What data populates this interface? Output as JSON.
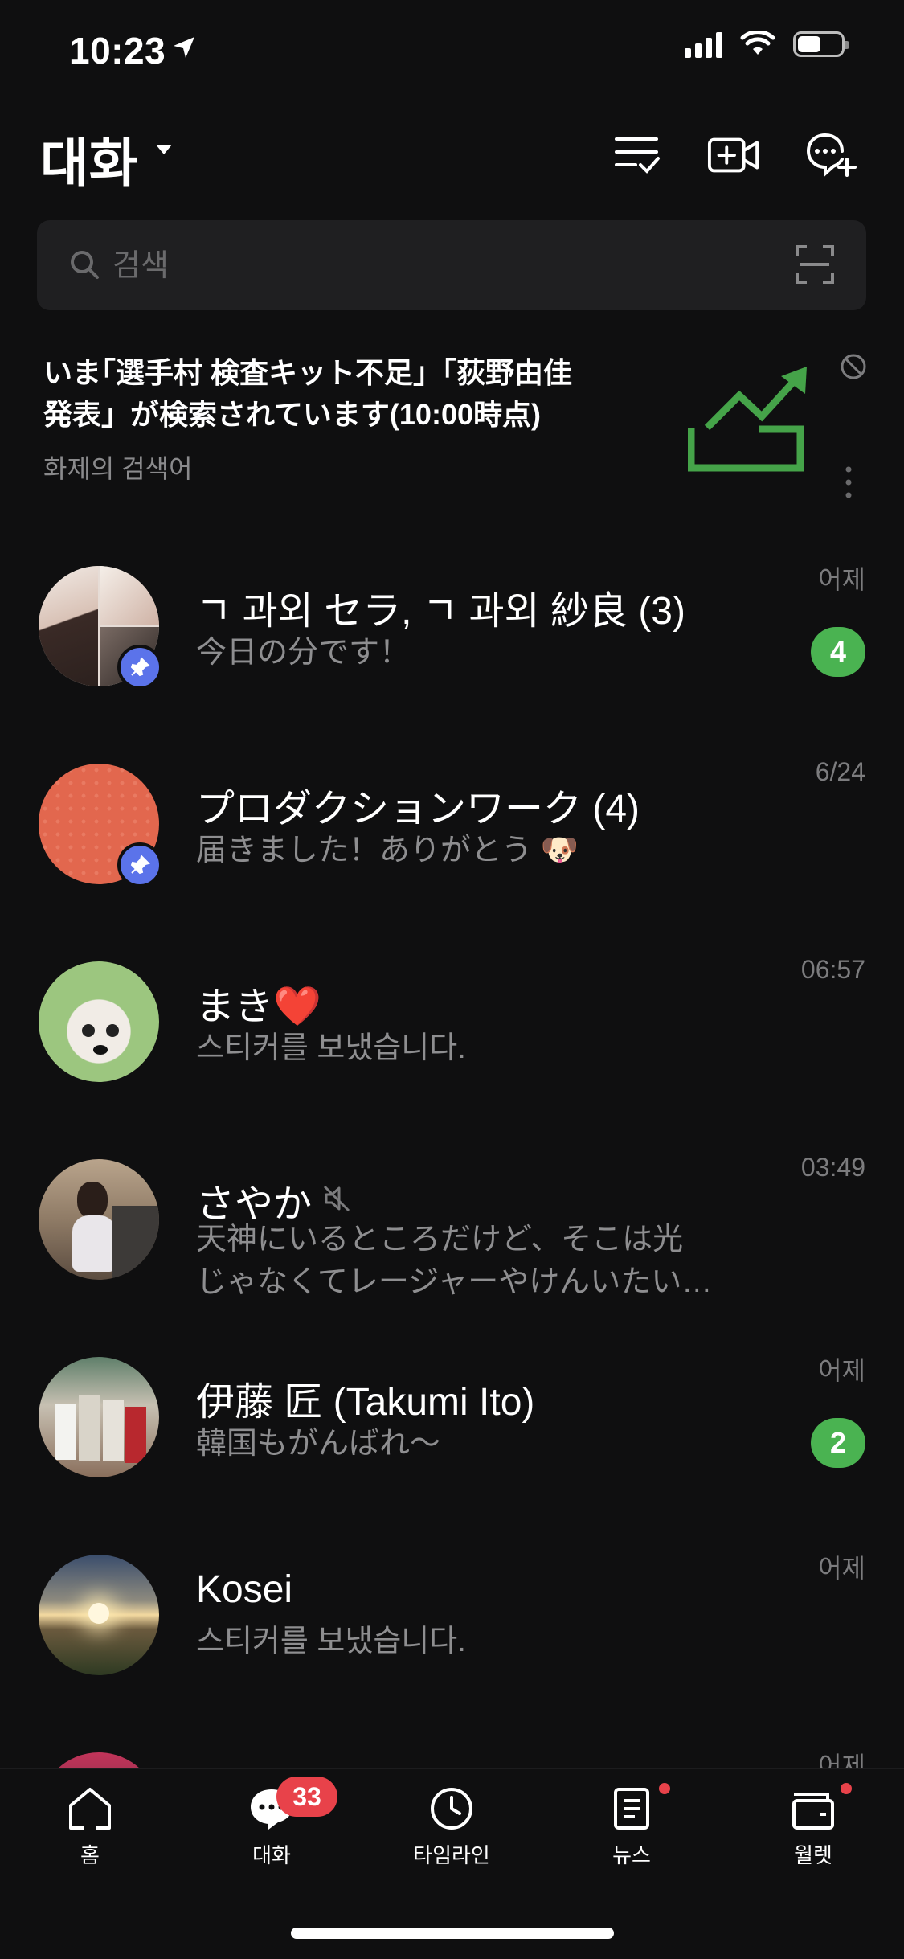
{
  "status_bar": {
    "time": "10:23"
  },
  "header": {
    "title": "대화"
  },
  "search": {
    "placeholder": "검색"
  },
  "trending": {
    "line1": "いま｢選手村 検査キット不足」「荻野由佳",
    "line2": "発表」が検索されています(10:00時点)",
    "caption": "화제의 검색어"
  },
  "chats": [
    {
      "name": "ㄱ 과외 セラ, ㄱ 과외 紗良 (3)",
      "preview": "今日の分です！",
      "time": "어제",
      "unread": "4",
      "pinned": true
    },
    {
      "name": "プロダクションワーク (4)",
      "preview": "届きました！ありがとう",
      "preview_emoji": "🐶",
      "time": "6/24",
      "pinned": true
    },
    {
      "name": "まき",
      "name_emoji": "❤️",
      "preview": "스티커를 보냈습니다.",
      "time": "06:57"
    },
    {
      "name": "さやか",
      "preview_line1": "天神にいるところだけど、そこは光",
      "preview_line2": "じゃなくてレージャーやけんいたい…",
      "time": "03:49",
      "muted": true
    },
    {
      "name": "伊藤 匠  (Takumi Ito)",
      "preview": "韓国もがんばれ〜",
      "time": "어제",
      "unread": "2"
    },
    {
      "name": "Kosei",
      "preview": "스티커를 보냈습니다.",
      "time": "어제"
    },
    {
      "time": "어제"
    }
  ],
  "tabbar": {
    "home": "홈",
    "chats": "대화",
    "chats_badge": "33",
    "timeline": "타임라인",
    "news": "뉴스",
    "wallet": "월렛"
  },
  "colors": {
    "accent_green": "#4ab351",
    "badge_red": "#e8424a",
    "pin_blue": "#5b73ea",
    "background": "#0f0f10"
  }
}
